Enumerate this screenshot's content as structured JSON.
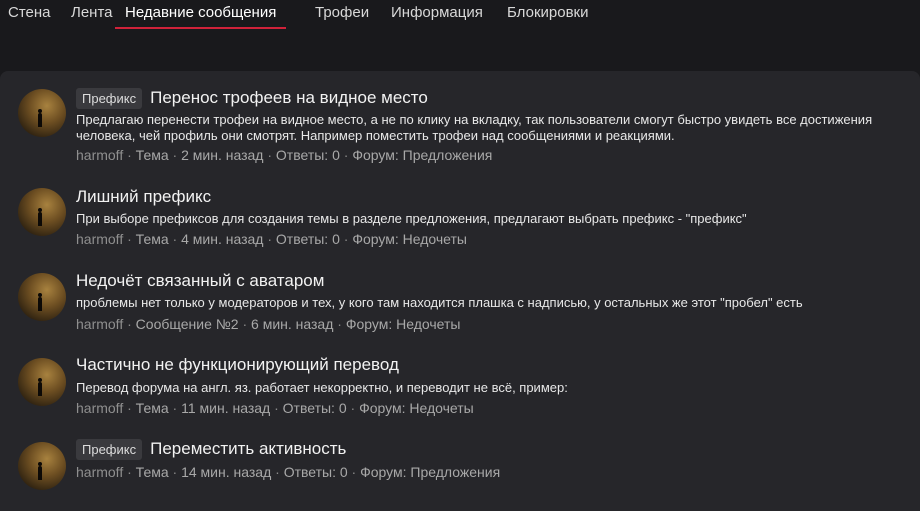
{
  "tabs": [
    {
      "label": "Стена",
      "active": false
    },
    {
      "label": "Лента",
      "active": false
    },
    {
      "label": "Недавние сообщения",
      "active": true
    },
    {
      "label": "Трофеи",
      "active": false
    },
    {
      "label": "Информация",
      "active": false
    },
    {
      "label": "Блокировки",
      "active": false
    }
  ],
  "colors": {
    "background": "#19191c",
    "panel": "#26262a",
    "accent": "#d0223a",
    "prefix_bg": "#3a3a3e"
  },
  "posts": [
    {
      "prefix": "Префикс",
      "title": "Перенос трофеев на видное место",
      "snippet": "Предлагаю перенести трофеи на видное место, а не по клику на вкладку, так пользователи смогут быстро увидеть все достижения человека, чей профиль они смотрят. Например поместить трофеи над сообщениями и реакциями.",
      "author": "harmoff",
      "type": "Тема",
      "time": "2 мин. назад",
      "replies": "Ответы: 0",
      "forum": "Форум: Предложения"
    },
    {
      "prefix": "",
      "title": "Лишний префикс",
      "snippet": "При выборе префиксов для создания темы в разделе предложения, предлагают выбрать префикс - \"префикс\"",
      "author": "harmoff",
      "type": "Тема",
      "time": "4 мин. назад",
      "replies": "Ответы: 0",
      "forum": "Форум: Недочеты"
    },
    {
      "prefix": "",
      "title": "Недочёт связанный с аватаром",
      "snippet": "проблемы нет только у модераторов и тех, у кого там находится плашка с надписью, у остальных же этот \"пробел\" есть",
      "author": "harmoff",
      "type": "Сообщение №2",
      "time": "6 мин. назад",
      "replies": "",
      "forum": "Форум: Недочеты"
    },
    {
      "prefix": "",
      "title": "Частично не функционирующий перевод",
      "snippet": "Перевод форума на англ. яз. работает некорректно, и переводит не всё, пример:",
      "author": "harmoff",
      "type": "Тема",
      "time": "11 мин. назад",
      "replies": "Ответы: 0",
      "forum": "Форум: Недочеты"
    },
    {
      "prefix": "Префикс",
      "title": "Переместить активность",
      "snippet": "",
      "author": "harmoff",
      "type": "Тема",
      "time": "14 мин. назад",
      "replies": "Ответы: 0",
      "forum": "Форум: Предложения"
    }
  ],
  "meta_separator": " · "
}
